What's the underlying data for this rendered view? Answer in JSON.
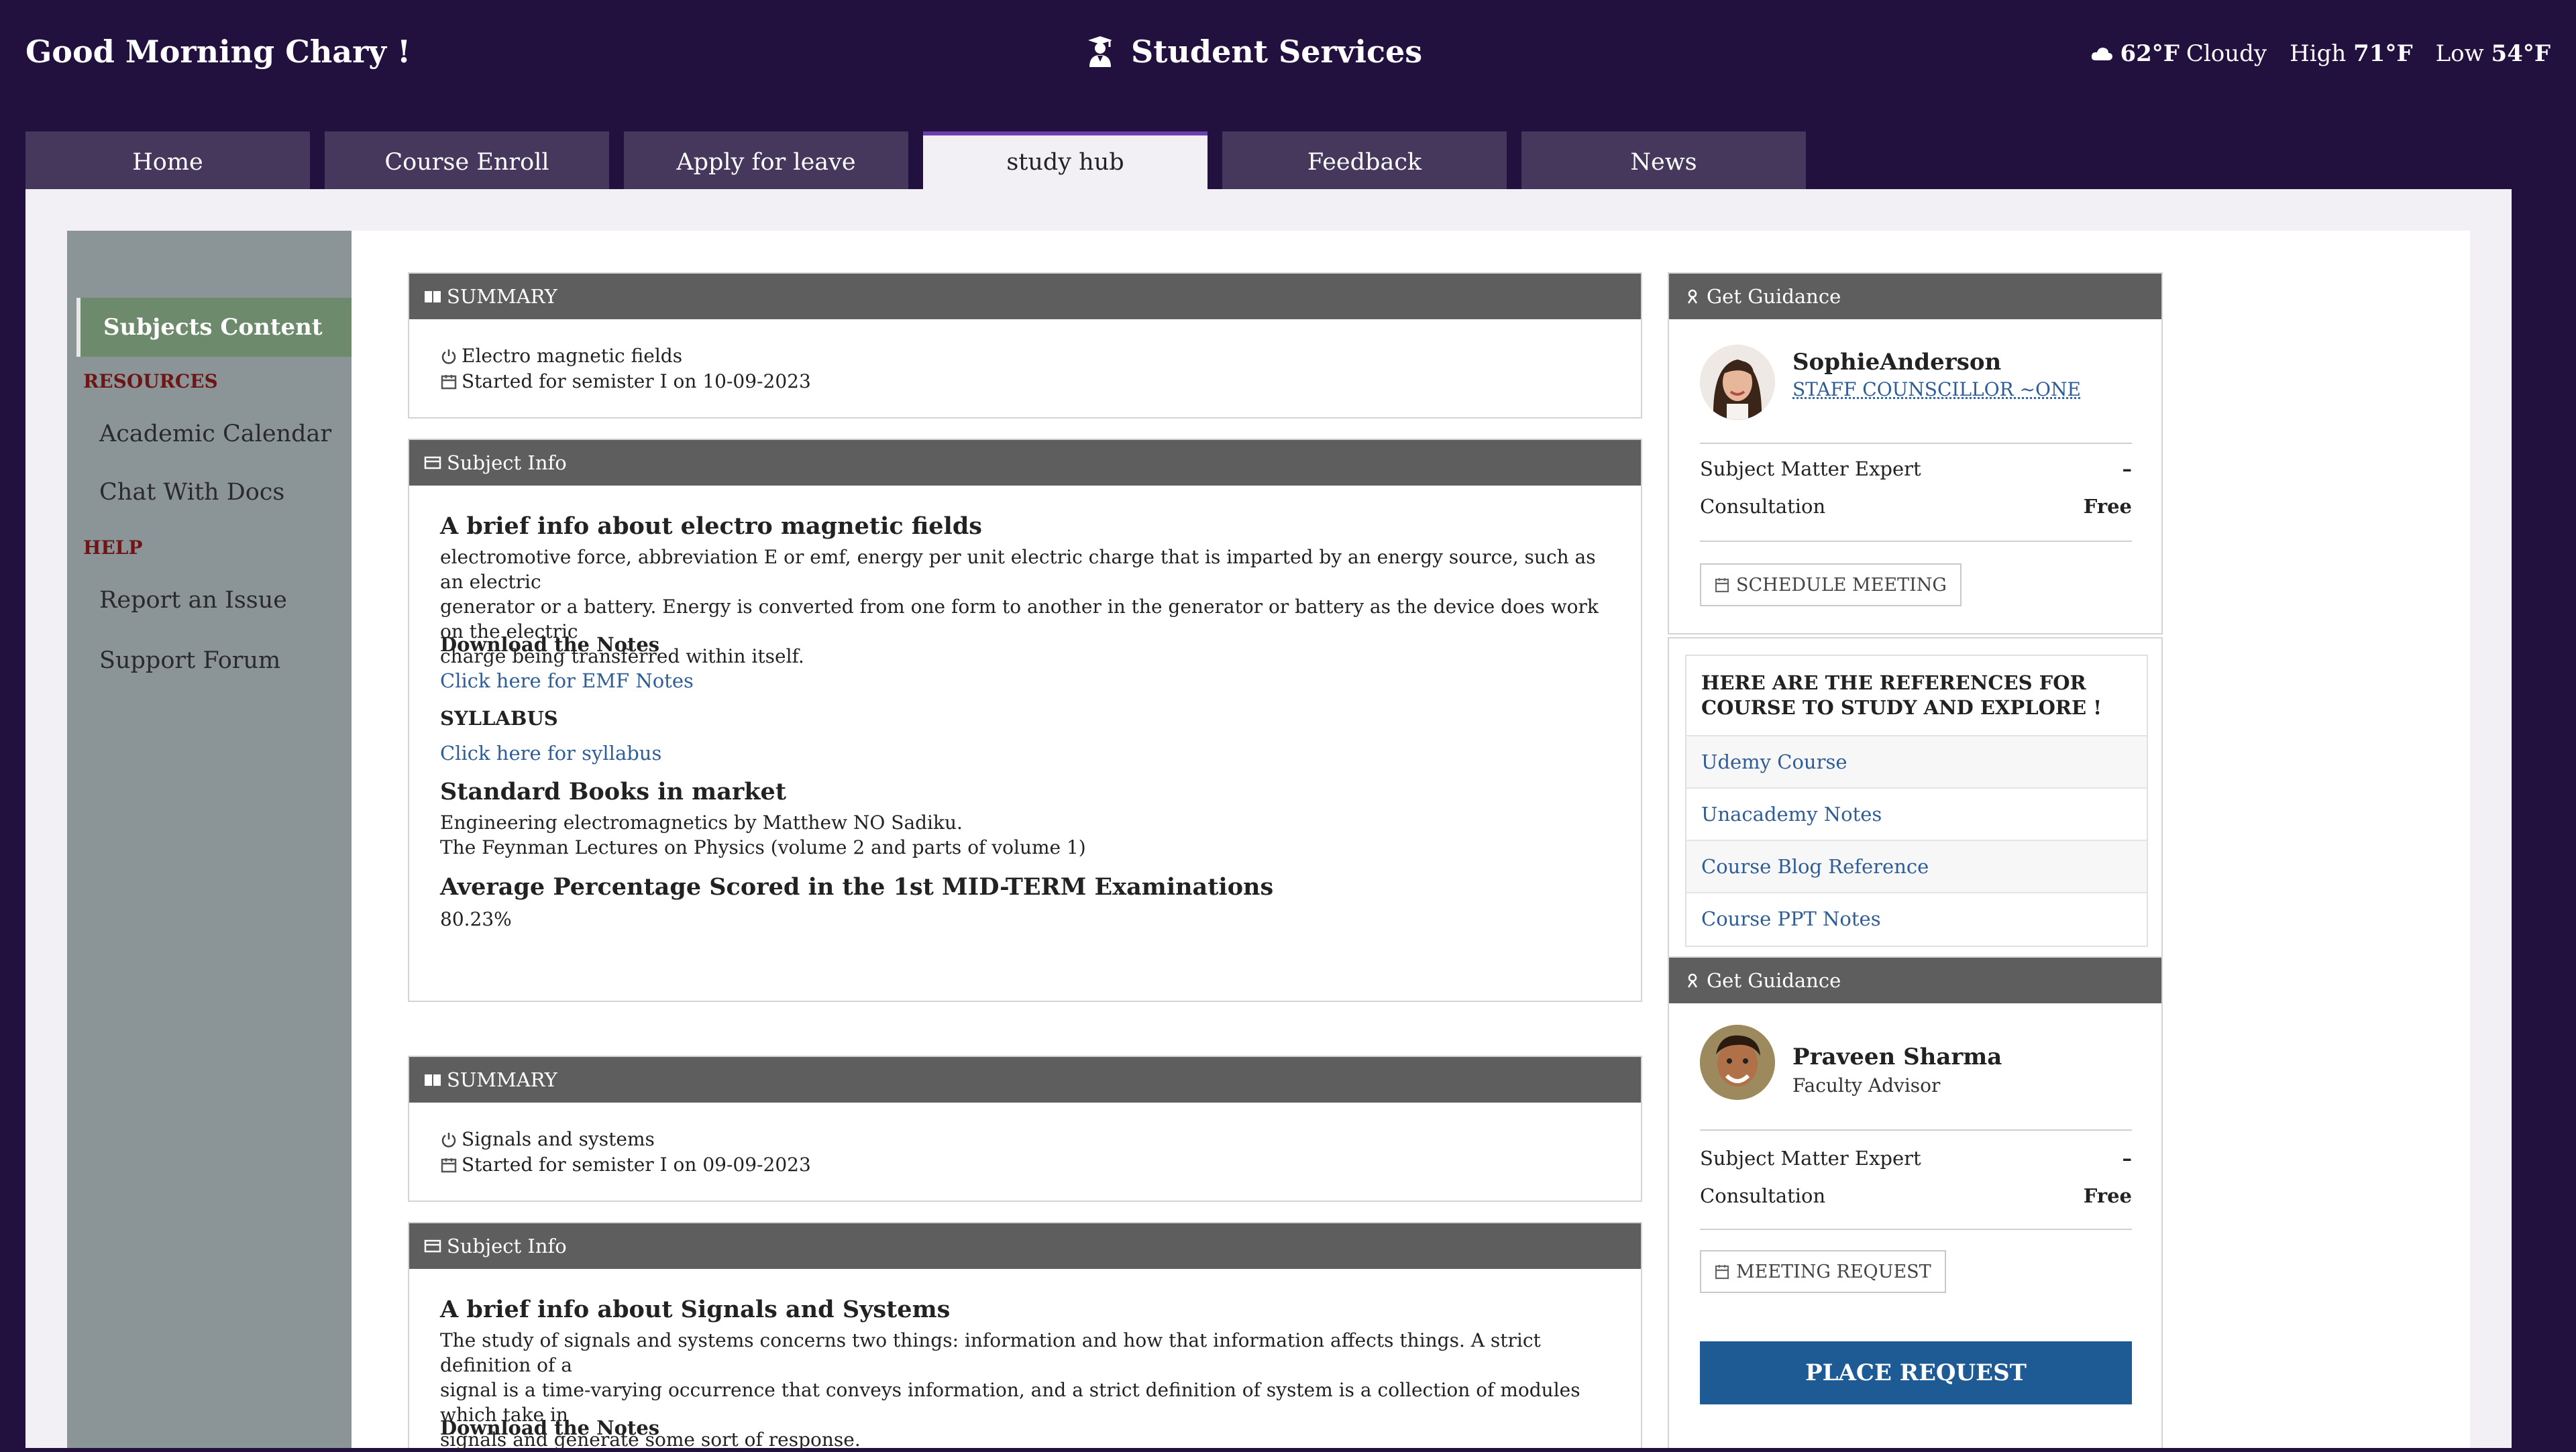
{
  "header": {
    "greeting": "Good Morning Chary !",
    "app_title": "Student Services",
    "weather": {
      "temp": "62°F",
      "condition": "Cloudy",
      "high_label": "High",
      "high": "71°F",
      "low_label": "Low",
      "low": "54°F"
    }
  },
  "tabs": [
    {
      "label": "Home"
    },
    {
      "label": "Course Enroll"
    },
    {
      "label": "Apply for leave"
    },
    {
      "label": "study hub",
      "active": true
    },
    {
      "label": "Feedback"
    },
    {
      "label": "News"
    }
  ],
  "sidebar": {
    "active": "Subjects Content",
    "resources_heading": "RESOURCES",
    "resources": [
      "Academic Calendar",
      "Chat With Docs"
    ],
    "help_heading": "HELP",
    "help": [
      "Report an Issue",
      "Support Forum"
    ]
  },
  "subjects": [
    {
      "summary_header": "SUMMARY",
      "name": "Electro magnetic fields",
      "started": "Started for semister I on 10-09-2023",
      "info_header": "Subject Info",
      "brief_title": "A brief info about electro magnetic fields",
      "brief_lines": [
        "electromotive force, abbreviation E or emf, energy per unit electric charge that is imparted by an energy source, such as an electric",
        "generator or a battery. Energy is converted from one form to another in the generator or battery as the device does work on the electric",
        "charge being transferred within itself."
      ],
      "download_label": "Download the Notes",
      "notes_link": "Click here for EMF Notes",
      "syllabus_label": "SYLLABUS",
      "syllabus_link": "Click here for syllabus",
      "books_title": "Standard Books in market",
      "books": [
        "Engineering electromagnetics by Matthew NO Sadiku.",
        "The Feynman Lectures on Physics (volume 2 and parts of volume 1)"
      ],
      "avg_title": "Average Percentage Scored in the 1st MID-TERM Examinations",
      "avg_value": "80.23%"
    },
    {
      "summary_header": "SUMMARY",
      "name": "Signals and systems",
      "started": "Started for semister I on 09-09-2023",
      "info_header": "Subject Info",
      "brief_title": "A brief info about Signals and Systems",
      "brief_lines": [
        "The study of signals and systems concerns two things: information and how that information affects things. A strict definition of a",
        "signal is a time-varying occurrence that conveys information, and a strict definition of system is a collection of modules which take in",
        "signals and generate some sort of response."
      ],
      "download_label": "Download the Notes"
    }
  ],
  "guidance": [
    {
      "header": "Get Guidance",
      "name": "SophieAnderson",
      "role": "STAFF COUNSCILLOR ~ONE",
      "expert_label": "Subject Matter Expert",
      "expert_value": "–",
      "consult_label": "Consultation",
      "consult_value": "Free",
      "button": "SCHEDULE MEETING"
    },
    {
      "header": "Get Guidance",
      "name": "Praveen Sharma",
      "role": "Faculty Advisor",
      "expert_label": "Subject Matter Expert",
      "expert_value": "–",
      "consult_label": "Consultation",
      "consult_value": "Free",
      "button": "MEETING REQUEST"
    }
  ],
  "references": {
    "title": "HERE ARE THE REFERENCES FOR COURSE TO STUDY AND EXPLORE !",
    "items": [
      "Udemy Course",
      "Unacademy Notes",
      "Course Blog Reference",
      "Course PPT Notes"
    ]
  },
  "place_request": "PLACE REQUEST",
  "colors": {
    "background": "#22103e",
    "tab": "#45385c",
    "tab_active_accent": "#6b3fb0",
    "sidebar": "#8b9597",
    "sidebar_active": "#6e8a6c",
    "panel_header": "#5e5e5e",
    "link": "#2f5d97",
    "primary_button": "#1e5b94"
  }
}
